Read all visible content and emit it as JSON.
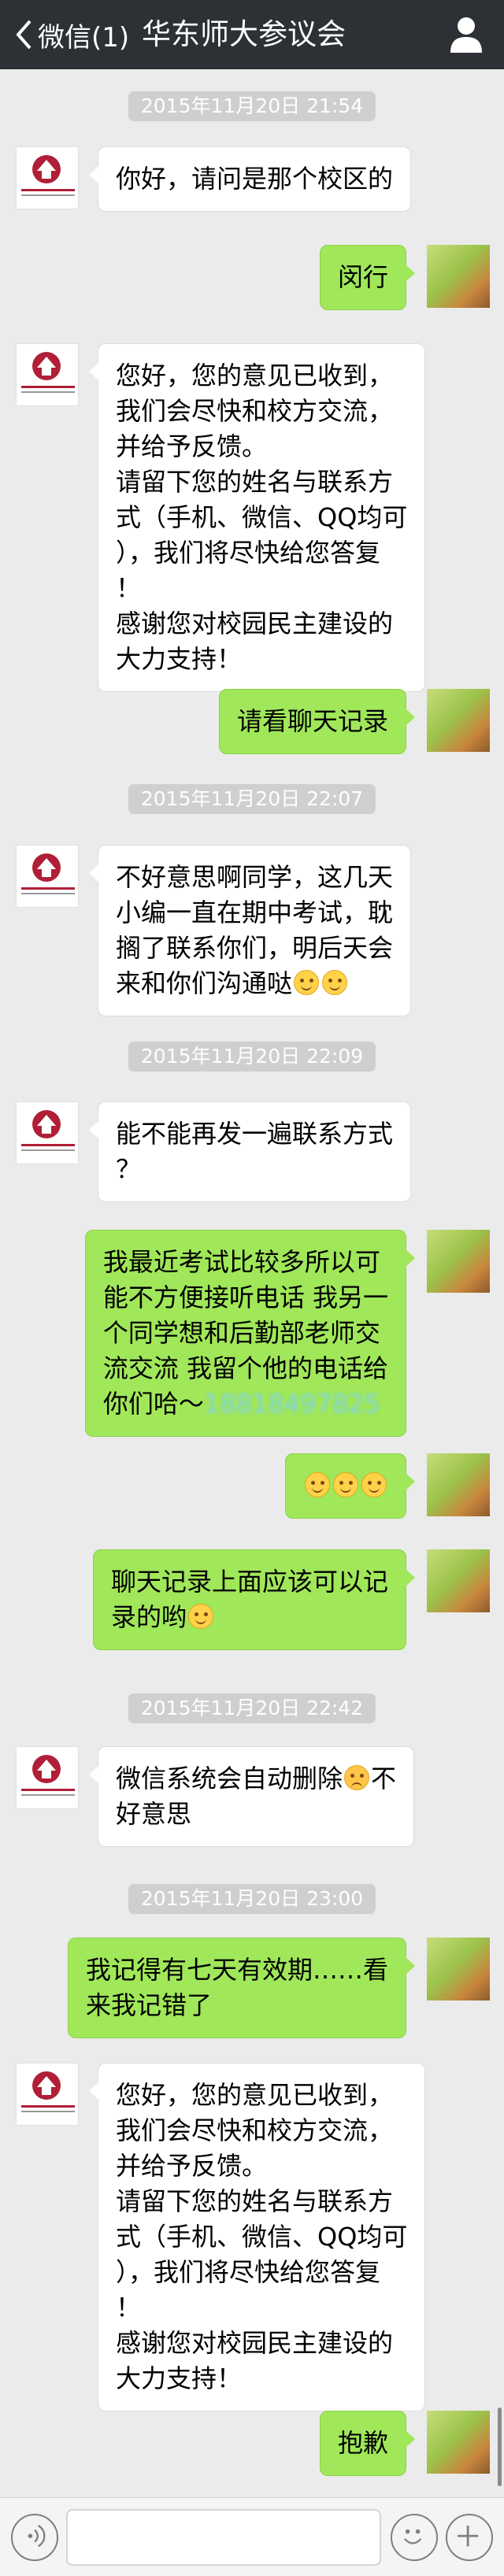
{
  "nav": {
    "back_label": "微信(1)",
    "title": "华东师大参议会",
    "back_icon": "chevron-left-icon",
    "profile_icon": "person-icon"
  },
  "timestamps": [
    "2015年11月20日 21:54",
    "2015年11月20日 22:07",
    "2015年11月20日 22:09",
    "2015年11月20日 22:42",
    "2015年11月20日 23:00"
  ],
  "messages": [
    {
      "from": "official",
      "lines": [
        "你好，请问是那个校区的"
      ]
    },
    {
      "from": "me",
      "lines": [
        "闵行"
      ]
    },
    {
      "from": "official",
      "lines": [
        "您好，您的意见已收到，",
        "我们会尽快和校方交流，",
        "并给予反馈。",
        "请留下您的姓名与联系方",
        "式（手机、微信、QQ均可",
        "），我们将尽快给您答复",
        "！",
        "感谢您对校园民主建设的",
        "大力支持！"
      ]
    },
    {
      "from": "me",
      "lines": [
        "请看聊天记录"
      ]
    },
    {
      "from": "official",
      "lines": [
        "不好意思啊同学，这几天",
        "小编一直在期中考试，耽",
        "搁了联系你们，明后天会",
        "来和你们沟通哒"
      ]
    },
    {
      "from": "official",
      "lines": [
        "能不能再发一遍联系方式",
        "？"
      ]
    },
    {
      "from": "me",
      "lines": [
        " 我最近考试比较多所以可",
        "能不方便接听电话 我另一",
        "个同学想和后勤部老师交",
        "流交流 我留个他的电话给",
        "你们哈～"
      ],
      "blurred": "18818497825"
    },
    {
      "from": "me",
      "lines": [
        ""
      ]
    },
    {
      "from": "me",
      "lines": [
        "聊天记录上面应该可以记",
        "录的哟"
      ]
    },
    {
      "from": "official",
      "lines": [
        "微信系统会自动删除",
        "好意思"
      ],
      "inline_after_emoji": "不"
    },
    {
      "from": "me",
      "lines": [
        "我记得有七天有效期……看",
        "来我记错了"
      ]
    },
    {
      "from": "official",
      "lines": [
        "您好，您的意见已收到，",
        "我们会尽快和校方交流，",
        "并给予反馈。",
        "请留下您的姓名与联系方",
        "式（手机、微信、QQ均可",
        "），我们将尽快给您答复",
        "！",
        "感谢您对校园民主建设的",
        "大力支持！"
      ]
    },
    {
      "from": "me",
      "lines": [
        "抱歉"
      ]
    }
  ],
  "emojis": {
    "smile": "smile-emoji",
    "sad": "sad-emoji"
  },
  "colors": {
    "nav_bg": "#2d3035",
    "chat_bg": "#ebebeb",
    "my_bubble": "#a0e759",
    "their_bubble": "#ffffff",
    "time_pill": "#cfcfcf"
  },
  "toolbar": {
    "voice_icon": "voice-icon",
    "emoji_icon": "emoji-icon",
    "plus_icon": "plus-icon"
  }
}
